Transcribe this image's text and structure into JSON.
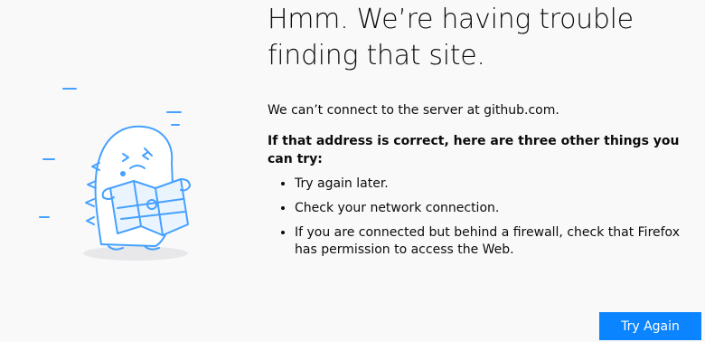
{
  "error": {
    "title": "Hmm. We’re having trouble finding that site.",
    "lead": "We can’t connect to the server at github.com.",
    "subhead": "If that address is correct, here are three other things you can try:",
    "suggestions": [
      "Try again later.",
      "Check your network connection.",
      "If you are connected but behind a firewall, check that Firefox has permission to access the Web."
    ]
  },
  "buttons": {
    "try_again": "Try Again"
  },
  "colors": {
    "background": "#f9f9fa",
    "accent": "#0a84ff",
    "illustration_stroke": "#45a1ff",
    "illustration_fill": "#ffffff"
  },
  "icons": {
    "illustration": "confused-dinosaur-with-map"
  }
}
